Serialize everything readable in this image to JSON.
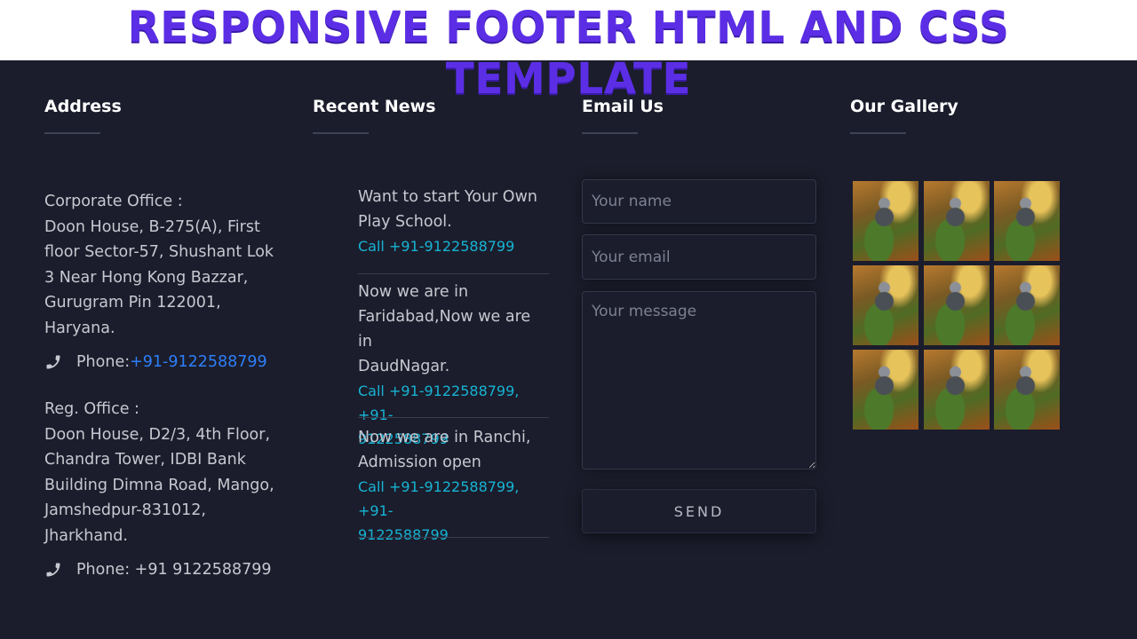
{
  "banner": {
    "title": "RESPONSIVE FOOTER HTML AND CSS TEMPLATE"
  },
  "columns": {
    "address": {
      "heading": "Address"
    },
    "news": {
      "heading": "Recent News"
    },
    "email": {
      "heading": "Email Us"
    },
    "gallery": {
      "heading": "Our Gallery"
    }
  },
  "address": {
    "corporate": {
      "label": "Corporate Office :",
      "lines": [
        "Doon House, B-275(A), First",
        "floor Sector-57, Shushant Lok",
        "3 Near Hong Kong Bazzar,",
        "Gurugram Pin 122001,",
        "Haryana."
      ],
      "phone_label": "Phone: ",
      "phone_value": "+91-9122588799"
    },
    "registered": {
      "label": "Reg. Office :",
      "lines": [
        "Doon House, D2/3, 4th Floor,",
        "Chandra Tower, IDBI Bank",
        "Building Dimna Road, Mango,",
        "Jamshedpur-831012,",
        "Jharkhand."
      ],
      "phone_label": "Phone: +91 9122588799"
    }
  },
  "news": {
    "items": [
      {
        "title_lines": [
          "Want to start Your Own",
          "Play School."
        ],
        "call_lines": [
          "Call +91-9122588799"
        ]
      },
      {
        "title_lines": [
          "Now we are in",
          "Faridabad,Now we are in",
          "DaudNagar."
        ],
        "call_lines": [
          "Call +91-9122588799, +91-",
          "9122588799"
        ]
      },
      {
        "title_lines": [
          "Now we are in Ranchi,",
          "Admission open"
        ],
        "call_lines": [
          "Call +91-9122588799, +91-",
          "9122588799"
        ]
      }
    ]
  },
  "form": {
    "name_placeholder": "Your name",
    "email_placeholder": "Your email",
    "message_placeholder": "Your message",
    "send_label": "SEND"
  },
  "gallery": {
    "rows": 3,
    "cols": 3
  },
  "icons": {
    "phone": "phone-icon"
  },
  "colors": {
    "background": "#1b1d2c",
    "banner_text": "#5b2ee6",
    "link_blue": "#2d7ff9",
    "call_cyan": "#17b3d3"
  }
}
